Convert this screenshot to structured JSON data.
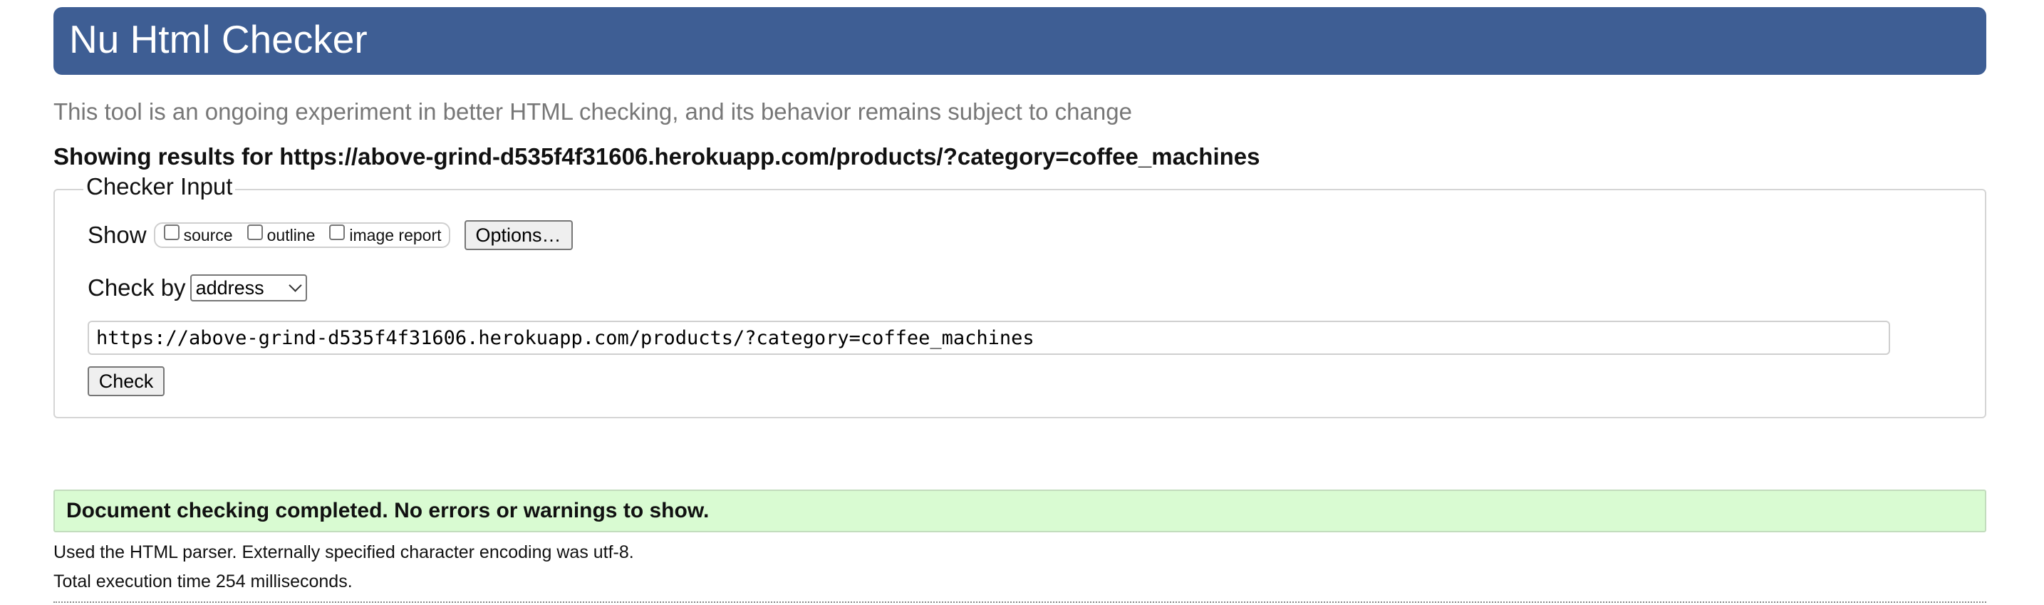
{
  "header": {
    "title": "Nu Html Checker",
    "tagline": "This tool is an ongoing experiment in better HTML checking, and its behavior remains subject to change"
  },
  "results_heading": "Showing results for https://above-grind-d535f4f31606.herokuapp.com/products/?category=coffee_machines",
  "checker_input": {
    "legend": "Checker Input",
    "show_label": "Show",
    "show_options": [
      {
        "label": "source",
        "checked": false
      },
      {
        "label": "outline",
        "checked": false
      },
      {
        "label": "image report",
        "checked": false
      }
    ],
    "options_button": "Options…",
    "check_by_label": "Check by",
    "check_by_value": "address",
    "url_value": "https://above-grind-d535f4f31606.herokuapp.com/products/?category=coffee_machines",
    "check_button": "Check"
  },
  "result": {
    "message": "Document checking completed. No errors or warnings to show.",
    "parser_info": "Used the HTML parser. Externally specified character encoding was utf-8.",
    "execution_time": "Total execution time 254 milliseconds."
  },
  "colors": {
    "banner": "#3e5e94",
    "success_bg": "#d9fbd2",
    "tagline": "#777777"
  }
}
